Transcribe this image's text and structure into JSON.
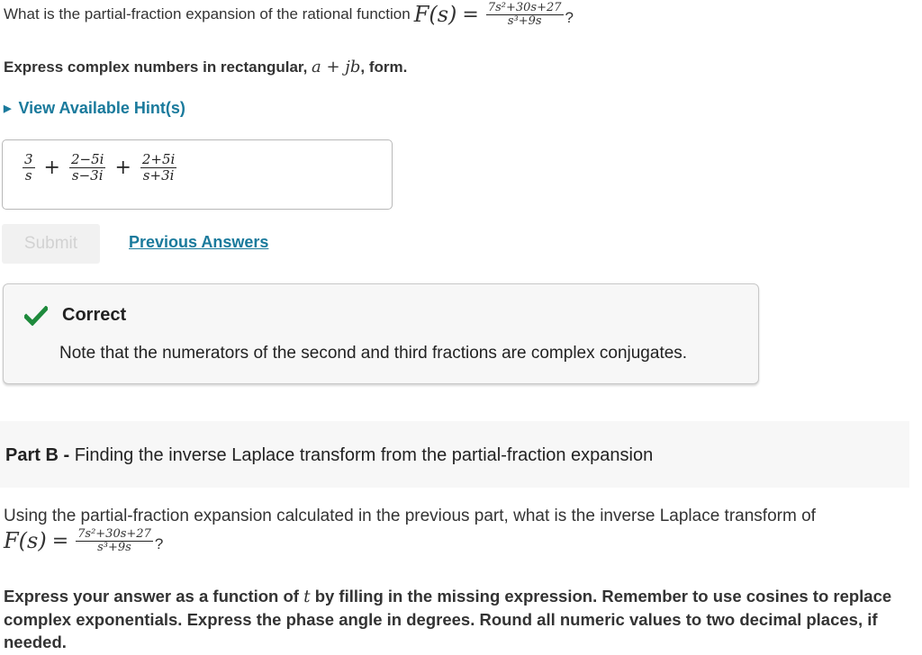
{
  "part_a": {
    "question_text": "What is the partial-fraction expansion of the rational function",
    "function": {
      "lhs": "F(s)",
      "equals": "=",
      "numerator": "7s²+30s+27",
      "denominator": "s³+9s",
      "suffix": "?"
    },
    "instruction_prefix": "Express complex numbers in rectangular,",
    "instruction_math": "a + jb",
    "instruction_suffix": ", form.",
    "hint_label": "View Available Hint(s)",
    "answer": {
      "terms": [
        {
          "numerator": "3",
          "denominator": "s"
        },
        {
          "numerator": "2−5i",
          "denominator": "s−3i"
        },
        {
          "numerator": "2+5i",
          "denominator": "s+3i"
        }
      ],
      "operator": "+"
    },
    "submit_label": "Submit",
    "previous_answers_label": "Previous Answers",
    "feedback": {
      "status": "Correct",
      "status_color": "#1e8a3c",
      "note": "Note that the numerators of the second and third fractions are complex conjugates."
    }
  },
  "part_b": {
    "label": "Part B -",
    "title": "Finding the inverse Laplace transform from the partial-fraction expansion",
    "question_text": "Using the partial-fraction expansion calculated in the previous part, what is the inverse Laplace transform of",
    "function": {
      "lhs": "F(s)",
      "equals": "=",
      "numerator": "7s²+30s+27",
      "denominator": "s³+9s",
      "suffix": "?"
    },
    "instruction_part1": "Express your answer as a function of",
    "instruction_var": "t",
    "instruction_part2": "by filling in the missing expression. Remember to use cosines to replace complex exponentials. Express the phase angle in degrees. Round all numeric values to two decimal places, if needed."
  },
  "colors": {
    "link": "#1a7a9c",
    "success": "#1e8a3c",
    "panel_bg": "#f7f7f7"
  }
}
